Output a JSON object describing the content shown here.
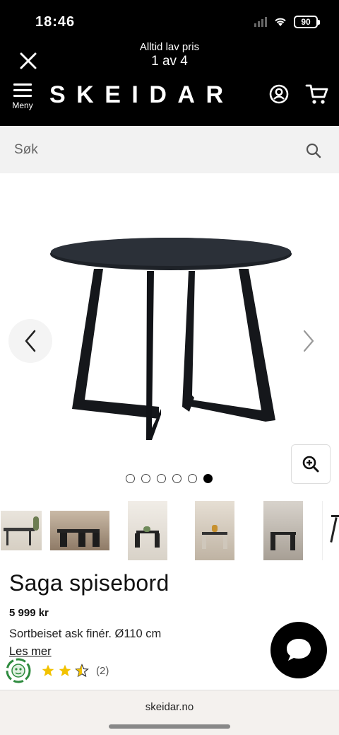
{
  "status_bar": {
    "time": "18:46",
    "battery": "90"
  },
  "header": {
    "promo_line1": "Alltid lav pris",
    "promo_line2": "1 av 4",
    "menu_label": "Meny",
    "logo": "SKEIDAR"
  },
  "search": {
    "placeholder": "Søk"
  },
  "gallery": {
    "dots_count": 6,
    "active_index": 5
  },
  "product": {
    "title": "Saga spisebord",
    "price": "5 999 kr",
    "description": "Sortbeiset ask finér. Ø110 cm",
    "read_more": "Les mer",
    "rating": 2.5,
    "review_count": "(2)"
  },
  "browser": {
    "url": "skeidar.no"
  },
  "colors": {
    "header_bg": "#000000",
    "search_bg": "#f2f2f2",
    "star": "#f2c200",
    "eco_green": "#2e8b3e"
  }
}
